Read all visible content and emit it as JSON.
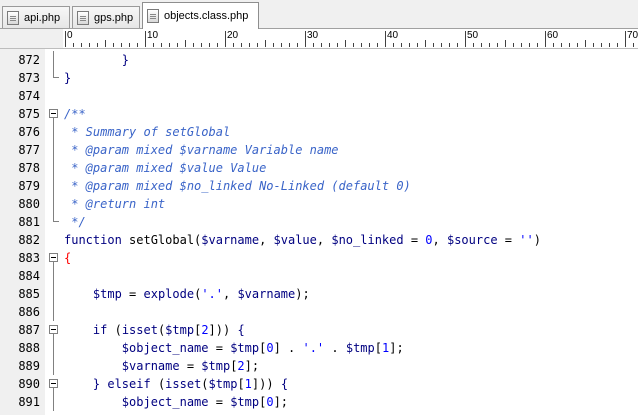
{
  "tabs": [
    {
      "label": "api.php",
      "active": false,
      "icon": "php-file-icon"
    },
    {
      "label": "gps.php",
      "active": false,
      "icon": "php-file-icon"
    },
    {
      "label": "objects.class.php",
      "active": true,
      "icon": "php-file-icon"
    }
  ],
  "ruler": {
    "labels": [
      "0",
      "10",
      "20",
      "30",
      "40",
      "50",
      "60",
      "70"
    ]
  },
  "colors": {
    "keyword": "#000080",
    "number": "#0000ff",
    "string": "#0000ff",
    "comment": "#3a64c8",
    "highlight_brace": "#ff0000",
    "gutter_bg": "#f0f0f0"
  },
  "lines": [
    {
      "n": "872",
      "fold": "line",
      "tokens": [
        [
          "        ",
          "plain"
        ],
        [
          "}",
          "brace"
        ]
      ]
    },
    {
      "n": "873",
      "fold": "end",
      "tokens": [
        [
          "}",
          "brace"
        ]
      ]
    },
    {
      "n": "874",
      "fold": "none",
      "tokens": []
    },
    {
      "n": "875",
      "fold": "open",
      "tokens": [
        [
          "/**",
          "com"
        ]
      ]
    },
    {
      "n": "876",
      "fold": "line",
      "tokens": [
        [
          " * Summary of setGlobal",
          "com"
        ]
      ]
    },
    {
      "n": "877",
      "fold": "line",
      "tokens": [
        [
          " * @param mixed $varname Variable name",
          "com"
        ]
      ]
    },
    {
      "n": "878",
      "fold": "line",
      "tokens": [
        [
          " * @param mixed $value Value",
          "com"
        ]
      ]
    },
    {
      "n": "879",
      "fold": "line",
      "tokens": [
        [
          " * @param mixed $no_linked No-Linked (default 0)",
          "com"
        ]
      ]
    },
    {
      "n": "880",
      "fold": "line",
      "tokens": [
        [
          " * @return int",
          "com"
        ]
      ]
    },
    {
      "n": "881",
      "fold": "end",
      "tokens": [
        [
          " */",
          "com"
        ]
      ]
    },
    {
      "n": "882",
      "fold": "none",
      "tokens": [
        [
          "function",
          "kw"
        ],
        [
          " setGlobal(",
          "plain"
        ],
        [
          "$varname",
          "var"
        ],
        [
          ", ",
          "plain"
        ],
        [
          "$value",
          "var"
        ],
        [
          ", ",
          "plain"
        ],
        [
          "$no_linked",
          "var"
        ],
        [
          " = ",
          "plain"
        ],
        [
          "0",
          "num"
        ],
        [
          ", ",
          "plain"
        ],
        [
          "$source",
          "var"
        ],
        [
          " = ",
          "plain"
        ],
        [
          "''",
          "str"
        ],
        [
          ")",
          "plain"
        ]
      ]
    },
    {
      "n": "883",
      "fold": "open",
      "tokens": [
        [
          "{",
          "hl"
        ]
      ]
    },
    {
      "n": "884",
      "fold": "line",
      "tokens": []
    },
    {
      "n": "885",
      "fold": "line",
      "tokens": [
        [
          "    ",
          "plain"
        ],
        [
          "$tmp",
          "var"
        ],
        [
          " = ",
          "plain"
        ],
        [
          "explode",
          "kw"
        ],
        [
          "(",
          "plain"
        ],
        [
          "'.'",
          "str"
        ],
        [
          ", ",
          "plain"
        ],
        [
          "$varname",
          "var"
        ],
        [
          ");",
          "plain"
        ]
      ]
    },
    {
      "n": "886",
      "fold": "line",
      "tokens": []
    },
    {
      "n": "887",
      "fold": "open",
      "tokens": [
        [
          "    ",
          "plain"
        ],
        [
          "if",
          "kw"
        ],
        [
          " (",
          "plain"
        ],
        [
          "isset",
          "kw"
        ],
        [
          "(",
          "plain"
        ],
        [
          "$tmp",
          "var"
        ],
        [
          "[",
          "plain"
        ],
        [
          "2",
          "num"
        ],
        [
          "])) ",
          "plain"
        ],
        [
          "{",
          "brace"
        ]
      ]
    },
    {
      "n": "888",
      "fold": "line",
      "tokens": [
        [
          "        ",
          "plain"
        ],
        [
          "$object_name",
          "var"
        ],
        [
          " = ",
          "plain"
        ],
        [
          "$tmp",
          "var"
        ],
        [
          "[",
          "plain"
        ],
        [
          "0",
          "num"
        ],
        [
          "] . ",
          "plain"
        ],
        [
          "'.'",
          "str"
        ],
        [
          " . ",
          "plain"
        ],
        [
          "$tmp",
          "var"
        ],
        [
          "[",
          "plain"
        ],
        [
          "1",
          "num"
        ],
        [
          "];",
          "plain"
        ]
      ]
    },
    {
      "n": "889",
      "fold": "line",
      "tokens": [
        [
          "        ",
          "plain"
        ],
        [
          "$varname",
          "var"
        ],
        [
          " = ",
          "plain"
        ],
        [
          "$tmp",
          "var"
        ],
        [
          "[",
          "plain"
        ],
        [
          "2",
          "num"
        ],
        [
          "];",
          "plain"
        ]
      ]
    },
    {
      "n": "890",
      "fold": "open",
      "tokens": [
        [
          "    ",
          "plain"
        ],
        [
          "} ",
          "brace"
        ],
        [
          "elseif",
          "kw"
        ],
        [
          " (",
          "plain"
        ],
        [
          "isset",
          "kw"
        ],
        [
          "(",
          "plain"
        ],
        [
          "$tmp",
          "var"
        ],
        [
          "[",
          "plain"
        ],
        [
          "1",
          "num"
        ],
        [
          "])) ",
          "plain"
        ],
        [
          "{",
          "brace"
        ]
      ]
    },
    {
      "n": "891",
      "fold": "line",
      "tokens": [
        [
          "        ",
          "plain"
        ],
        [
          "$object_name",
          "var"
        ],
        [
          " = ",
          "plain"
        ],
        [
          "$tmp",
          "var"
        ],
        [
          "[",
          "plain"
        ],
        [
          "0",
          "num"
        ],
        [
          "];",
          "plain"
        ]
      ]
    }
  ]
}
